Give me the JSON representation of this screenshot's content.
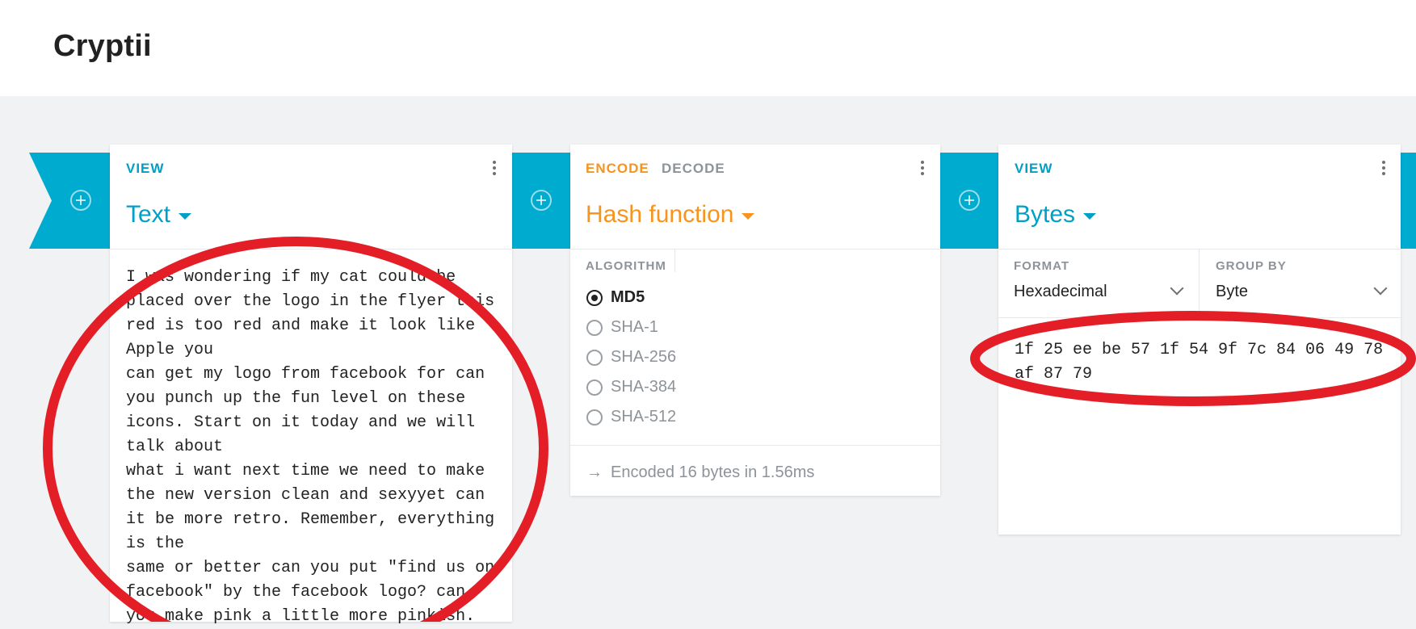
{
  "app": {
    "title": "Cryptii"
  },
  "brick1": {
    "tab": "VIEW",
    "title": "Text",
    "content": "I was wondering if my cat could be placed over the logo in the flyer this red is too red and make it look like Apple you\ncan get my logo from facebook for can you punch up the fun level on these icons. Start on it today and we will talk about\nwhat i want next time we need to make the new version clean and sexyyet can it be more retro. Remember, everything is the\nsame or better can you put \"find us on facebook\" by the facebook logo? can you make pink a little more pinkish."
  },
  "brick2": {
    "tab_encode": "ENCODE",
    "tab_decode": "DECODE",
    "title": "Hash function",
    "algorithm_label": "ALGORITHM",
    "options": [
      {
        "label": "MD5",
        "selected": true
      },
      {
        "label": "SHA-1",
        "selected": false
      },
      {
        "label": "SHA-256",
        "selected": false
      },
      {
        "label": "SHA-384",
        "selected": false
      },
      {
        "label": "SHA-512",
        "selected": false
      }
    ],
    "status": "Encoded 16 bytes in 1.56ms"
  },
  "brick3": {
    "tab": "VIEW",
    "title": "Bytes",
    "format_label": "FORMAT",
    "format_value": "Hexadecimal",
    "group_label": "GROUP BY",
    "group_value": "Byte",
    "content": "1f 25 ee be 57 1f 54 9f 7c 84 06 49 78 af 87 79"
  },
  "colors": {
    "accent_blue": "#00a0c6",
    "accent_orange": "#f6941d",
    "annotation_red": "#e41e26"
  }
}
